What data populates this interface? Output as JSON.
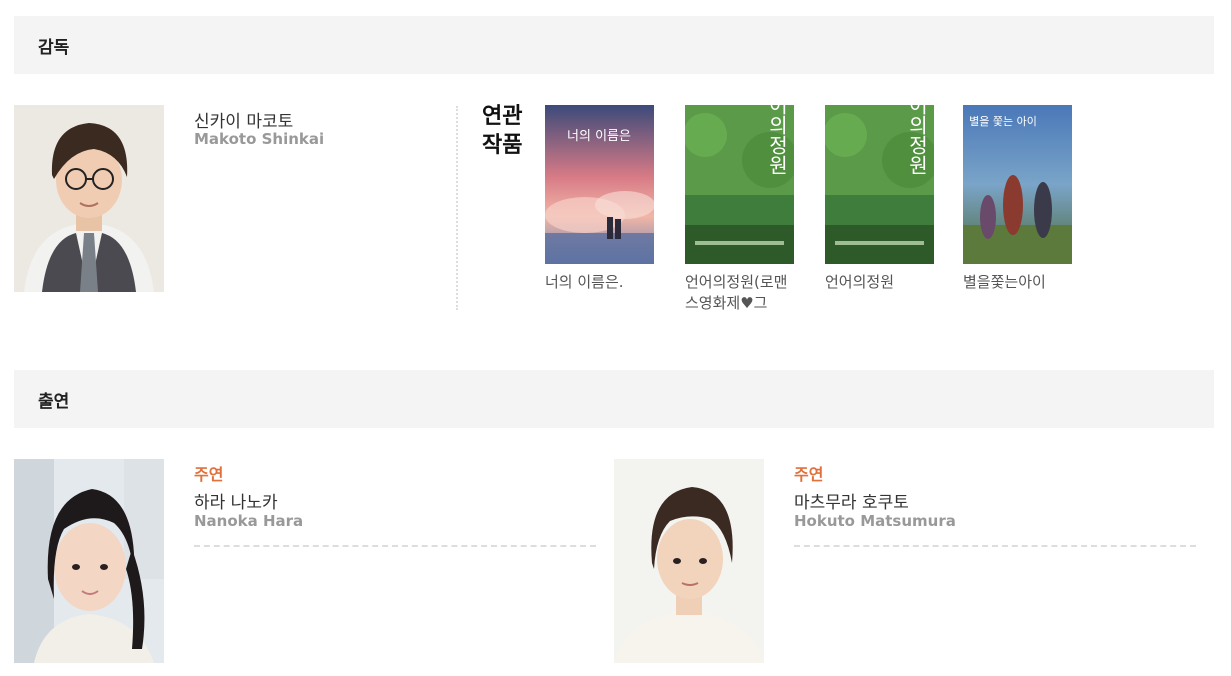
{
  "director": {
    "section_title": "감독",
    "name_ko": "신카이 마코토",
    "name_en": "Makoto Shinkai",
    "related_title": "연관 작품",
    "works": [
      {
        "title": "너의 이름은.",
        "poster_text": "너의 이름은"
      },
      {
        "title": "언어의정원(로맨스영화제♥그",
        "poster_text": "언어의정원"
      },
      {
        "title": "언어의정원",
        "poster_text": "언어의정원"
      },
      {
        "title": "별을쫓는아이",
        "poster_text": "별을 쫓는 아이"
      }
    ]
  },
  "cast": {
    "section_title": "출연",
    "members": [
      {
        "role": "주연",
        "name_ko": "하라 나노카",
        "name_en": "Nanoka Hara"
      },
      {
        "role": "주연",
        "name_ko": "마츠무라 호쿠토",
        "name_en": "Hokuto Matsumura"
      }
    ]
  },
  "colors": {
    "accent": "#e2703a",
    "header_bg": "#f4f4f4",
    "muted": "#999999"
  }
}
